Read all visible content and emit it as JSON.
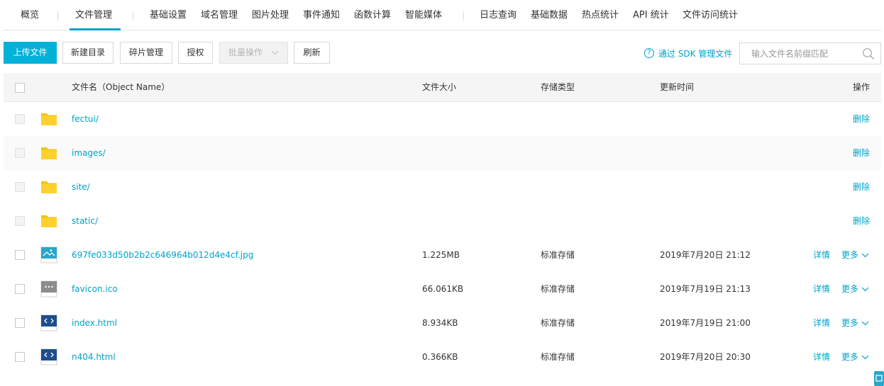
{
  "nav": {
    "tabs": [
      {
        "label": "概览"
      },
      {
        "label": "文件管理"
      },
      {
        "label": "基础设置"
      },
      {
        "label": "域名管理"
      },
      {
        "label": "图片处理"
      },
      {
        "label": "事件通知"
      },
      {
        "label": "函数计算"
      },
      {
        "label": "智能媒体"
      },
      {
        "label": "日志查询"
      },
      {
        "label": "基础数据"
      },
      {
        "label": "热点统计"
      },
      {
        "label": "API 统计"
      },
      {
        "label": "文件访问统计"
      }
    ],
    "active": "文件管理"
  },
  "toolbar": {
    "upload_label": "上传文件",
    "new_dir_label": "新建目录",
    "fragment_label": "碎片管理",
    "authorize_label": "授权",
    "batch_label": "批量操作",
    "refresh_label": "刷新",
    "sdk_link_label": "通过 SDK 管理文件",
    "search_placeholder": "输入文件名前缀匹配"
  },
  "table": {
    "headers": {
      "name": "文件名（Object Name）",
      "size": "文件大小",
      "storage": "存储类型",
      "updated": "更新时间",
      "actions": "操作"
    },
    "rows": [
      {
        "type": "folder",
        "name": "fectui/",
        "size": "",
        "storage": "",
        "updated": "",
        "action": "删除"
      },
      {
        "type": "folder",
        "name": "images/",
        "size": "",
        "storage": "",
        "updated": "",
        "action": "删除"
      },
      {
        "type": "folder",
        "name": "site/",
        "size": "",
        "storage": "",
        "updated": "",
        "action": "删除"
      },
      {
        "type": "folder",
        "name": "static/",
        "size": "",
        "storage": "",
        "updated": "",
        "action": "删除"
      },
      {
        "type": "image",
        "name": "697fe033d50b2b2c646964b012d4e4cf.jpg",
        "size": "1.225MB",
        "storage": "标准存储",
        "updated": "2019年7月20日 21:12",
        "detail": "详情",
        "more": "更多"
      },
      {
        "type": "ico",
        "name": "favicon.ico",
        "size": "66.061KB",
        "storage": "标准存储",
        "updated": "2019年7月19日 21:13",
        "detail": "详情",
        "more": "更多"
      },
      {
        "type": "html",
        "name": "index.html",
        "size": "8.934KB",
        "storage": "标准存储",
        "updated": "2019年7月19日 21:00",
        "detail": "详情",
        "more": "更多"
      },
      {
        "type": "html",
        "name": "n404.html",
        "size": "0.366KB",
        "storage": "标准存储",
        "updated": "2019年7月20日 20:30",
        "detail": "详情",
        "more": "更多"
      }
    ]
  },
  "colors": {
    "accent": "#00a2ca",
    "primary_button": "#00b2d8",
    "folder": "#f5c518",
    "html_icon": "#1e4e8c"
  },
  "icons": {
    "folder": "folder-icon",
    "image": "image-file-icon",
    "ico": "ico-file-icon",
    "html": "html-file-icon",
    "search": "search-icon",
    "help": "help-circle-icon",
    "chevron": "chevron-down-icon"
  }
}
